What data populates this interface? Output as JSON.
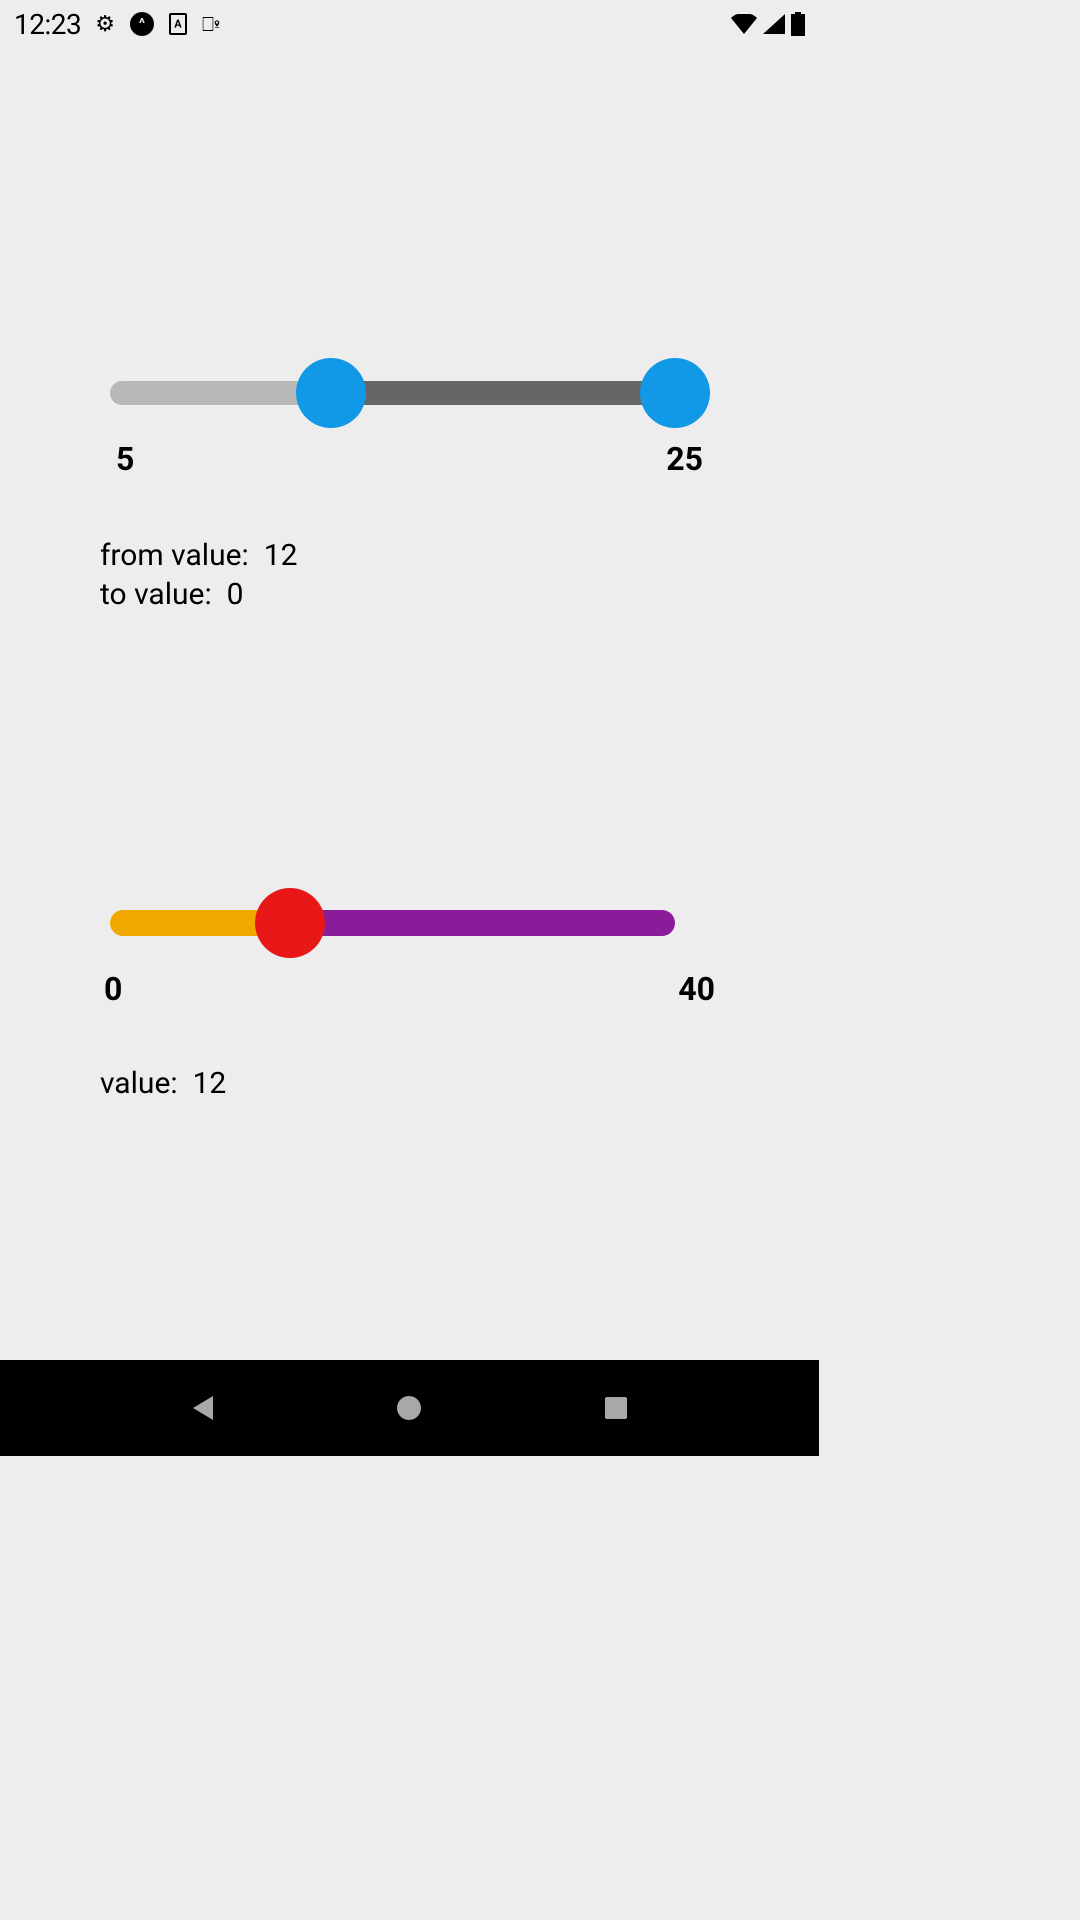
{
  "status_bar": {
    "time": "12:23"
  },
  "range_slider": {
    "min_label": "5",
    "max_label": "25",
    "min": 5,
    "max": 25,
    "from": 12,
    "to": 25,
    "from_readout_label": "from value:",
    "from_readout_value": "12",
    "to_readout_label": "to value:",
    "to_readout_value": "0"
  },
  "single_slider": {
    "min_label": "0",
    "max_label": "40",
    "min": 0,
    "max": 40,
    "value": 12,
    "readout_label": "value:",
    "readout_value": "12"
  }
}
